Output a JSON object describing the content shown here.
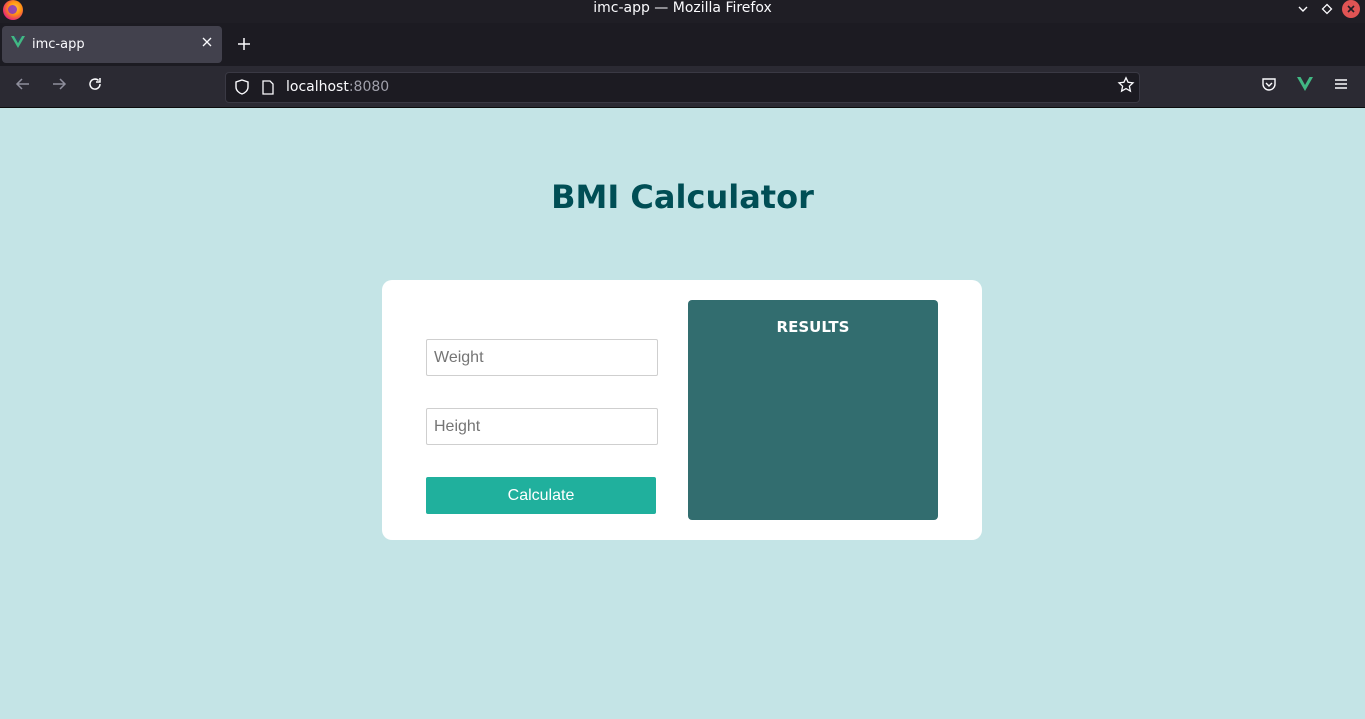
{
  "window": {
    "title": "imc-app — Mozilla Firefox"
  },
  "tabs": [
    {
      "label": "imc-app",
      "favicon": "vue-logo-icon"
    }
  ],
  "navbar": {
    "url_host": "localhost",
    "url_port": ":8080"
  },
  "page": {
    "title": "BMI Calculator",
    "weight_placeholder": "Weight",
    "height_placeholder": "Height",
    "calculate_label": "Calculate",
    "results_title": "RESULTS"
  },
  "colors": {
    "background": "#c4e4e6",
    "title": "#004e55",
    "button": "#20b09d",
    "results_panel": "#326d6f"
  }
}
